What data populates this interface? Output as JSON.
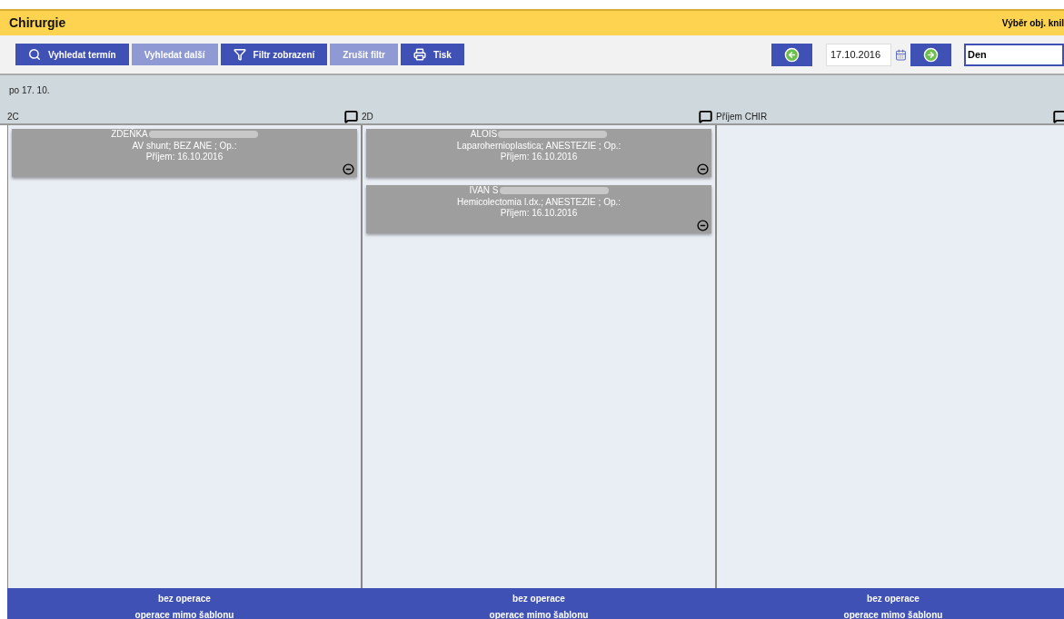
{
  "header": {
    "title": "Chirurgie",
    "right_text": "Výběr obj. knil"
  },
  "toolbar": {
    "buttons": [
      {
        "label": "Vyhledat termín",
        "kind": "search",
        "disabled": false
      },
      {
        "label": "Vyhledat další",
        "kind": "plain",
        "disabled": true
      },
      {
        "label": "Filtr zobrazení",
        "kind": "filter",
        "disabled": false
      },
      {
        "label": "Zrušit filtr",
        "kind": "plain",
        "disabled": true
      },
      {
        "label": "Tisk",
        "kind": "print",
        "disabled": false
      }
    ],
    "date": "17.10.2016",
    "view": "Den"
  },
  "day_label": "po 17. 10.",
  "columns": [
    {
      "name": "2C",
      "cards": [
        {
          "name": "ZDEŇKA",
          "lines": [
            "AV shunt; BEZ ANE ; Op.:",
            "Příjem: 16.10.2016"
          ]
        }
      ],
      "footer": [
        "bez operace",
        "operace mimo šablonu"
      ]
    },
    {
      "name": "2D",
      "cards": [
        {
          "name": "ALOIS",
          "lines": [
            "Laparohernioplastica; ANESTEZIE ; Op.:",
            "Příjem: 16.10.2016"
          ]
        },
        {
          "name": "IVAN S",
          "lines": [
            "Hemicolectomia l.dx.; ANESTEZIE ; Op.:",
            "Příjem: 16.10.2016"
          ]
        }
      ],
      "footer": [
        "bez operace",
        "operace mimo šablonu"
      ]
    },
    {
      "name": "Příjem CHIR",
      "footer": [
        "bez operace",
        "operace mimo šablonu"
      ]
    }
  ]
}
